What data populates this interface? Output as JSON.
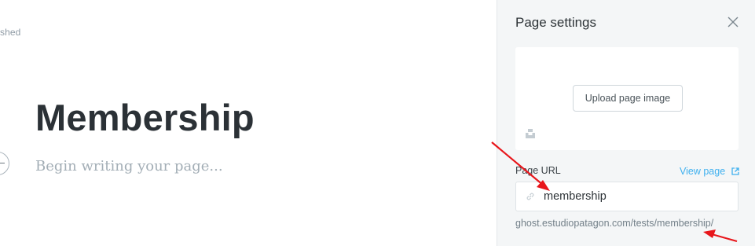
{
  "editor": {
    "status_text": "shed",
    "title": "Membership",
    "body_placeholder": "Begin writing your page..."
  },
  "settings": {
    "title": "Page settings",
    "upload_image_label": "Upload page image",
    "url_label": "Page URL",
    "view_page_label": "View page",
    "url_value": "membership",
    "url_preview": "ghost.estudiopatagon.com/tests/membership/"
  },
  "colors": {
    "accent_link": "#3eb0ef",
    "annotation_red": "#e8161b",
    "panel_bg": "#f4f6f7",
    "title_text": "#2b3136"
  },
  "icons": {
    "close": "close-icon",
    "link": "link-icon",
    "external": "external-link-icon",
    "unsplash": "unsplash-icon",
    "add": "plus-icon"
  }
}
